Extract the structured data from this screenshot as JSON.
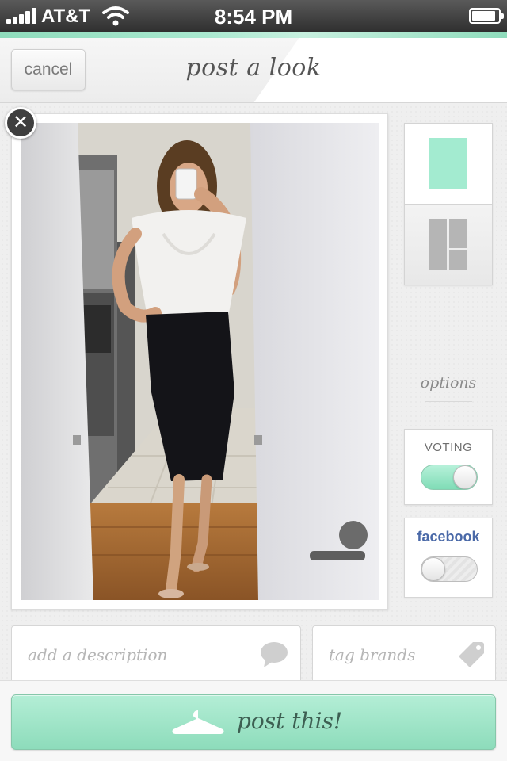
{
  "status_bar": {
    "carrier": "AT&T",
    "time": "8:54 PM",
    "icons": [
      "signal-icon",
      "wifi-icon",
      "battery-icon"
    ],
    "battery_level": 0.9
  },
  "header": {
    "cancel_label": "cancel",
    "title": "post a look"
  },
  "photo": {
    "remove_icon": "close-icon",
    "remove_glyph": "✕"
  },
  "layout_selector": {
    "options": [
      "single-photo-layout",
      "grid-layout"
    ],
    "selected": "single-photo-layout"
  },
  "options": {
    "label": "options",
    "voting": {
      "label": "VOTING",
      "enabled": true
    },
    "facebook": {
      "label": "facebook",
      "enabled": false
    }
  },
  "description": {
    "placeholder": "add a description",
    "value": "",
    "icon": "speech-bubble-icon"
  },
  "tags": {
    "placeholder": "tag brands",
    "value": "",
    "icon": "tag-icon"
  },
  "post_button": {
    "label": "post this!",
    "icon": "hanger-icon"
  },
  "colors": {
    "accent": "#a3ebd0",
    "accent_dark": "#8ddcbb",
    "facebook_blue": "#4a69a8"
  }
}
